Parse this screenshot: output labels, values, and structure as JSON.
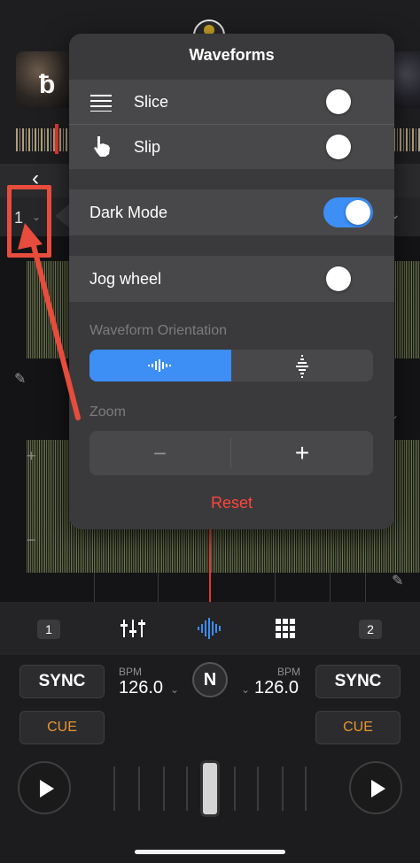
{
  "popover": {
    "title": "Waveforms",
    "items": [
      {
        "label": "Slice",
        "icon": "list-lines-icon",
        "toggle_on": false
      },
      {
        "label": "Slip",
        "icon": "tap-hand-icon",
        "toggle_on": false
      },
      {
        "label": "Dark Mode",
        "toggle_on": true
      },
      {
        "label": "Jog wheel",
        "toggle_on": false
      }
    ],
    "orientation_label": "Waveform Orientation",
    "orientation_options": [
      "horizontal-wave-icon",
      "vertical-wave-icon"
    ],
    "orientation_selected": 0,
    "zoom_label": "Zoom",
    "zoom_minus": "−",
    "zoom_plus": "+",
    "reset_label": "Reset"
  },
  "deck": {
    "number": "1"
  },
  "tabbar": {
    "deck1": "1",
    "deck2": "2",
    "active_tab": "waveform"
  },
  "controls": {
    "sync_left": "SYNC",
    "sync_right": "SYNC",
    "cue_left": "CUE",
    "cue_right": "CUE",
    "bpm_label_left": "BPM",
    "bpm_label_right": "BPM",
    "bpm_left": "126.0",
    "bpm_right": "126.0",
    "center_logo": "N"
  },
  "colors": {
    "accent": "#3d8ef5",
    "cue": "#e8962e",
    "reset": "#ff453a",
    "playhead": "#e53935",
    "annotation": "#e74c3c"
  }
}
